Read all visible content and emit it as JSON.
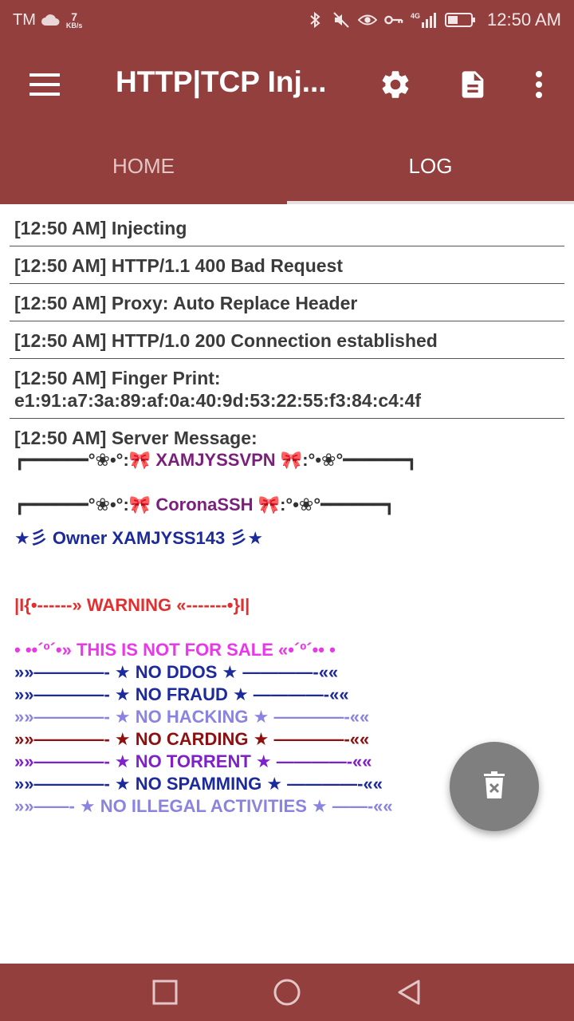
{
  "status_bar": {
    "carrier": "TM",
    "speed_value": "7",
    "speed_unit": "KB/s",
    "network": "4G",
    "time": "12:50 AM"
  },
  "toolbar": {
    "title": "HTTP|TCP Inj..."
  },
  "tabs": [
    {
      "label": "HOME",
      "active": false
    },
    {
      "label": "LOG",
      "active": true
    }
  ],
  "log": {
    "entries": [
      "[12:50 AM] Injecting",
      "[12:50 AM] HTTP/1.1 400 Bad Request",
      "[12:50 AM] Proxy: Auto Replace Header",
      "[12:50 AM] HTTP/1.0 200 Connection established",
      "[12:50 AM] Finger Print: e1:91:a7:3a:89:af:0a:40:9d:53:22:55:f3:84:c4:4f"
    ],
    "server_message": {
      "header": "[12:50 AM] Server Message:",
      "box1_left": "┏━━━━━━°❀•°:",
      "box1_name": "XAMJYSSVPN",
      "box1_right": ":°•❀°━━━━━━┓",
      "box2_left": "┏━━━━━━°❀•°:",
      "box2_name": "CoronaSSH",
      "box2_right": ":°•❀°━━━━━━┓",
      "owner": "★彡 Owner XAMJYSS143 彡★",
      "warning": "|I{•------» WARNING «-------•}I|",
      "not_for_sale": "• ••´º´•» THIS IS NOT FOR SALE «•´º´•• •",
      "rules": [
        {
          "text": "»»————- ★ NO DDOS ★ ————-««",
          "color": "navy"
        },
        {
          "text": "»»————- ★ NO FRAUD ★ ————-««",
          "color": "navy"
        },
        {
          "text": "»»————- ★ NO HACKING ★ ————-««",
          "color": "lav"
        },
        {
          "text": "»»————- ★ NO CARDING ★ ————-««",
          "color": "maroon"
        },
        {
          "text": "»»————- ★ NO TORRENT ★ ————-««",
          "color": "violet"
        },
        {
          "text": "»»————- ★ NO SPAMMING ★ ————-««",
          "color": "navy"
        },
        {
          "text": "»»——- ★ NO ILLEGAL ACTIVITIES ★ ——-««",
          "color": "lav"
        }
      ]
    }
  },
  "colors": {
    "primary": "#923f3e",
    "fab": "#7f7f7f"
  },
  "icons": {
    "menu": "hamburger-icon",
    "settings": "gear-icon",
    "document": "document-icon",
    "more": "more-vertical-icon",
    "fab": "trash-icon"
  }
}
